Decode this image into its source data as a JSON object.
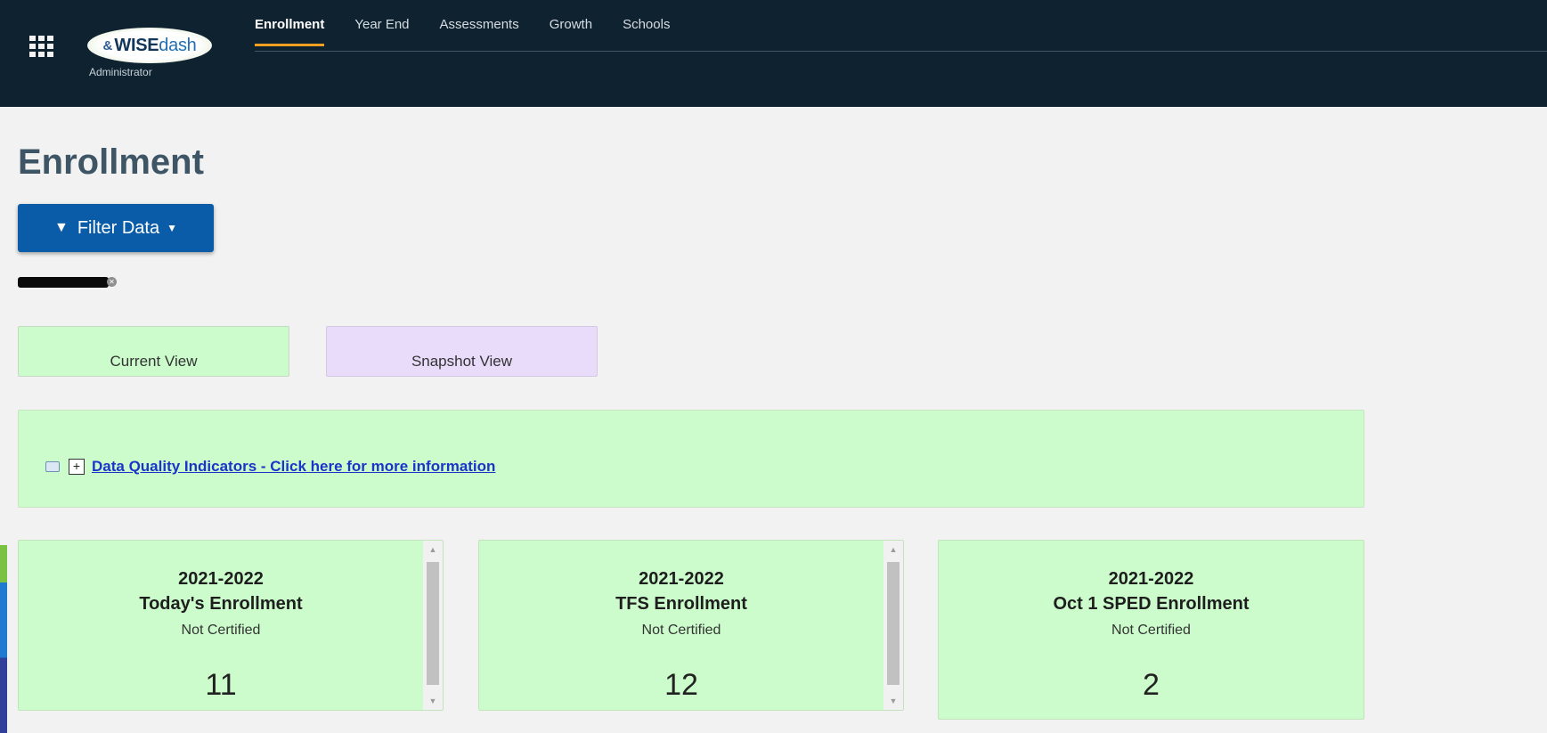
{
  "app": {
    "logo_mark": "&",
    "logo_wise": "WISE",
    "logo_dash": "dash",
    "role": "Administrator"
  },
  "topnav": {
    "tabs": [
      {
        "label": "Enrollment",
        "active": true
      },
      {
        "label": "Year End",
        "active": false
      },
      {
        "label": "Assessments",
        "active": false
      },
      {
        "label": "Growth",
        "active": false
      },
      {
        "label": "Schools",
        "active": false
      }
    ]
  },
  "page": {
    "title": "Enrollment",
    "filter_button": "Filter Data",
    "views": {
      "current": "Current View",
      "snapshot": "Snapshot View"
    },
    "dq_link": "Data Quality Indicators - Click here for more information",
    "dq_toggle": "+"
  },
  "cards": [
    {
      "year": "2021-2022",
      "title": "Today's Enrollment",
      "status": "Not Certified",
      "value": "11"
    },
    {
      "year": "2021-2022",
      "title": "TFS Enrollment",
      "status": "Not Certified",
      "value": "12"
    },
    {
      "year": "2021-2022",
      "title": "Oct 1 SPED Enrollment",
      "status": "Not Certified",
      "value": "2"
    }
  ],
  "colors": {
    "topbar": "#0f2230",
    "accent_tab": "#f0a020",
    "primary_button": "#0b5ca8",
    "card_green": "#ccfccc",
    "snapshot_purple": "#e9dbfa",
    "link_blue": "#1a35c8"
  },
  "icons": {
    "app_launcher": "grid-icon",
    "filter": "funnel-icon",
    "dropdown": "caret-down-icon",
    "data_quality": "report-icon"
  }
}
